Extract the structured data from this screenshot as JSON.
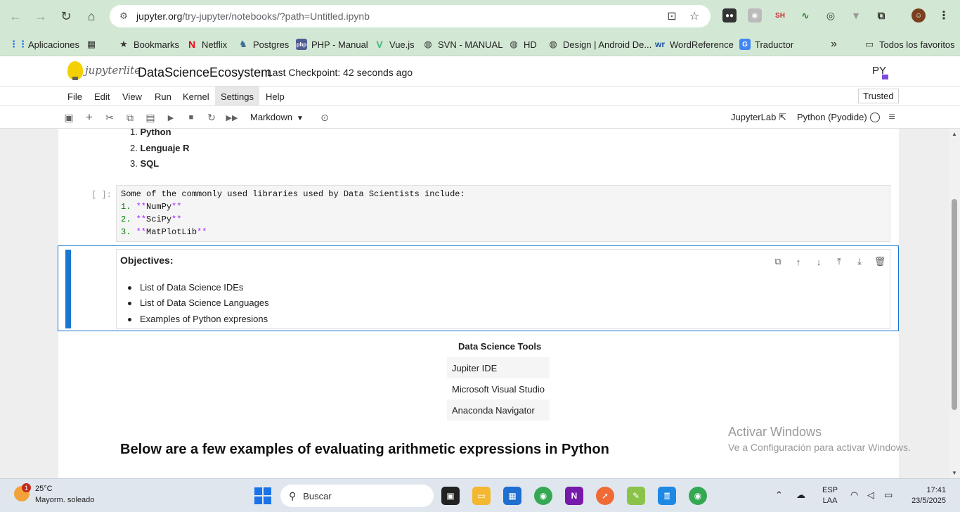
{
  "browser": {
    "url_main": "jupyter.org",
    "url_path": "/try-jupyter/notebooks/?path=Untitled.ipynb",
    "bookmarks": [
      {
        "label": "Aplicaciones"
      },
      {
        "label": "Bookmarks"
      },
      {
        "label": "Netflix"
      },
      {
        "label": "Postgres"
      },
      {
        "label": "PHP - Manual"
      },
      {
        "label": "Vue.js"
      },
      {
        "label": "SVN - MANUAL"
      },
      {
        "label": "HD"
      },
      {
        "label": "Design | Android De..."
      },
      {
        "label": "WordReference"
      },
      {
        "label": "Traductor"
      }
    ],
    "more_bookmarks": "»",
    "all_bookmarks": "Todos los favoritos",
    "ext_sh": "SH"
  },
  "jupyter": {
    "logo_text": "jupyterlite",
    "notebook_title": "DataScienceEcosystem",
    "checkpoint": "Last Checkpoint: 42 seconds ago",
    "menu": [
      "File",
      "Edit",
      "View",
      "Run",
      "Kernel",
      "Settings",
      "Help"
    ],
    "trusted": "Trusted",
    "cell_type": "Markdown",
    "jupyterlab_link": "JupyterLab",
    "kernel_name": "Python (Pyodide)",
    "py_logo": "PY"
  },
  "notebook": {
    "languages": [
      {
        "num": "1.",
        "label": "Python"
      },
      {
        "num": "2.",
        "label": "Lenguaje R"
      },
      {
        "num": "3.",
        "label": "SQL"
      }
    ],
    "raw_prompt": "[ ]:",
    "raw_lines": {
      "intro": "Some of the commonly used libraries used by Data Scientists include:",
      "l1_num": "1.",
      "l1_name": "NumPy",
      "l2_num": "2.",
      "l2_name": "SciPy",
      "l3_num": "3.",
      "l3_name": "MatPlotLib",
      "stars": "**"
    },
    "objectives_title": "Objectives:",
    "objectives": [
      "List of Data Science IDEs",
      "List of Data Science Languages",
      "Examples of Python expresions"
    ],
    "tools_header": "Data Science Tools",
    "tools": [
      "Jupiter IDE",
      "Microsoft Visual Studio",
      "Anaconda Navigator"
    ],
    "heading": "Below are a few examples of evaluating arithmetic expressions in Python"
  },
  "watermark": {
    "line1": "Activar Windows",
    "line2": "Ve a Configuración para activar Windows."
  },
  "taskbar": {
    "weather_temp": "25°C",
    "weather_desc": "Mayorm. soleado",
    "weather_badge": "1",
    "search_placeholder": "Buscar",
    "lang_line1": "ESP",
    "lang_line2": "LAA",
    "time": "17:41",
    "date": "23/5/2025"
  },
  "colors": {
    "browser_bar": "#d3e8d4",
    "jupyter_accent": "#1976d2",
    "code_num": "#008000",
    "markdown_marker": "#aa22ff"
  }
}
